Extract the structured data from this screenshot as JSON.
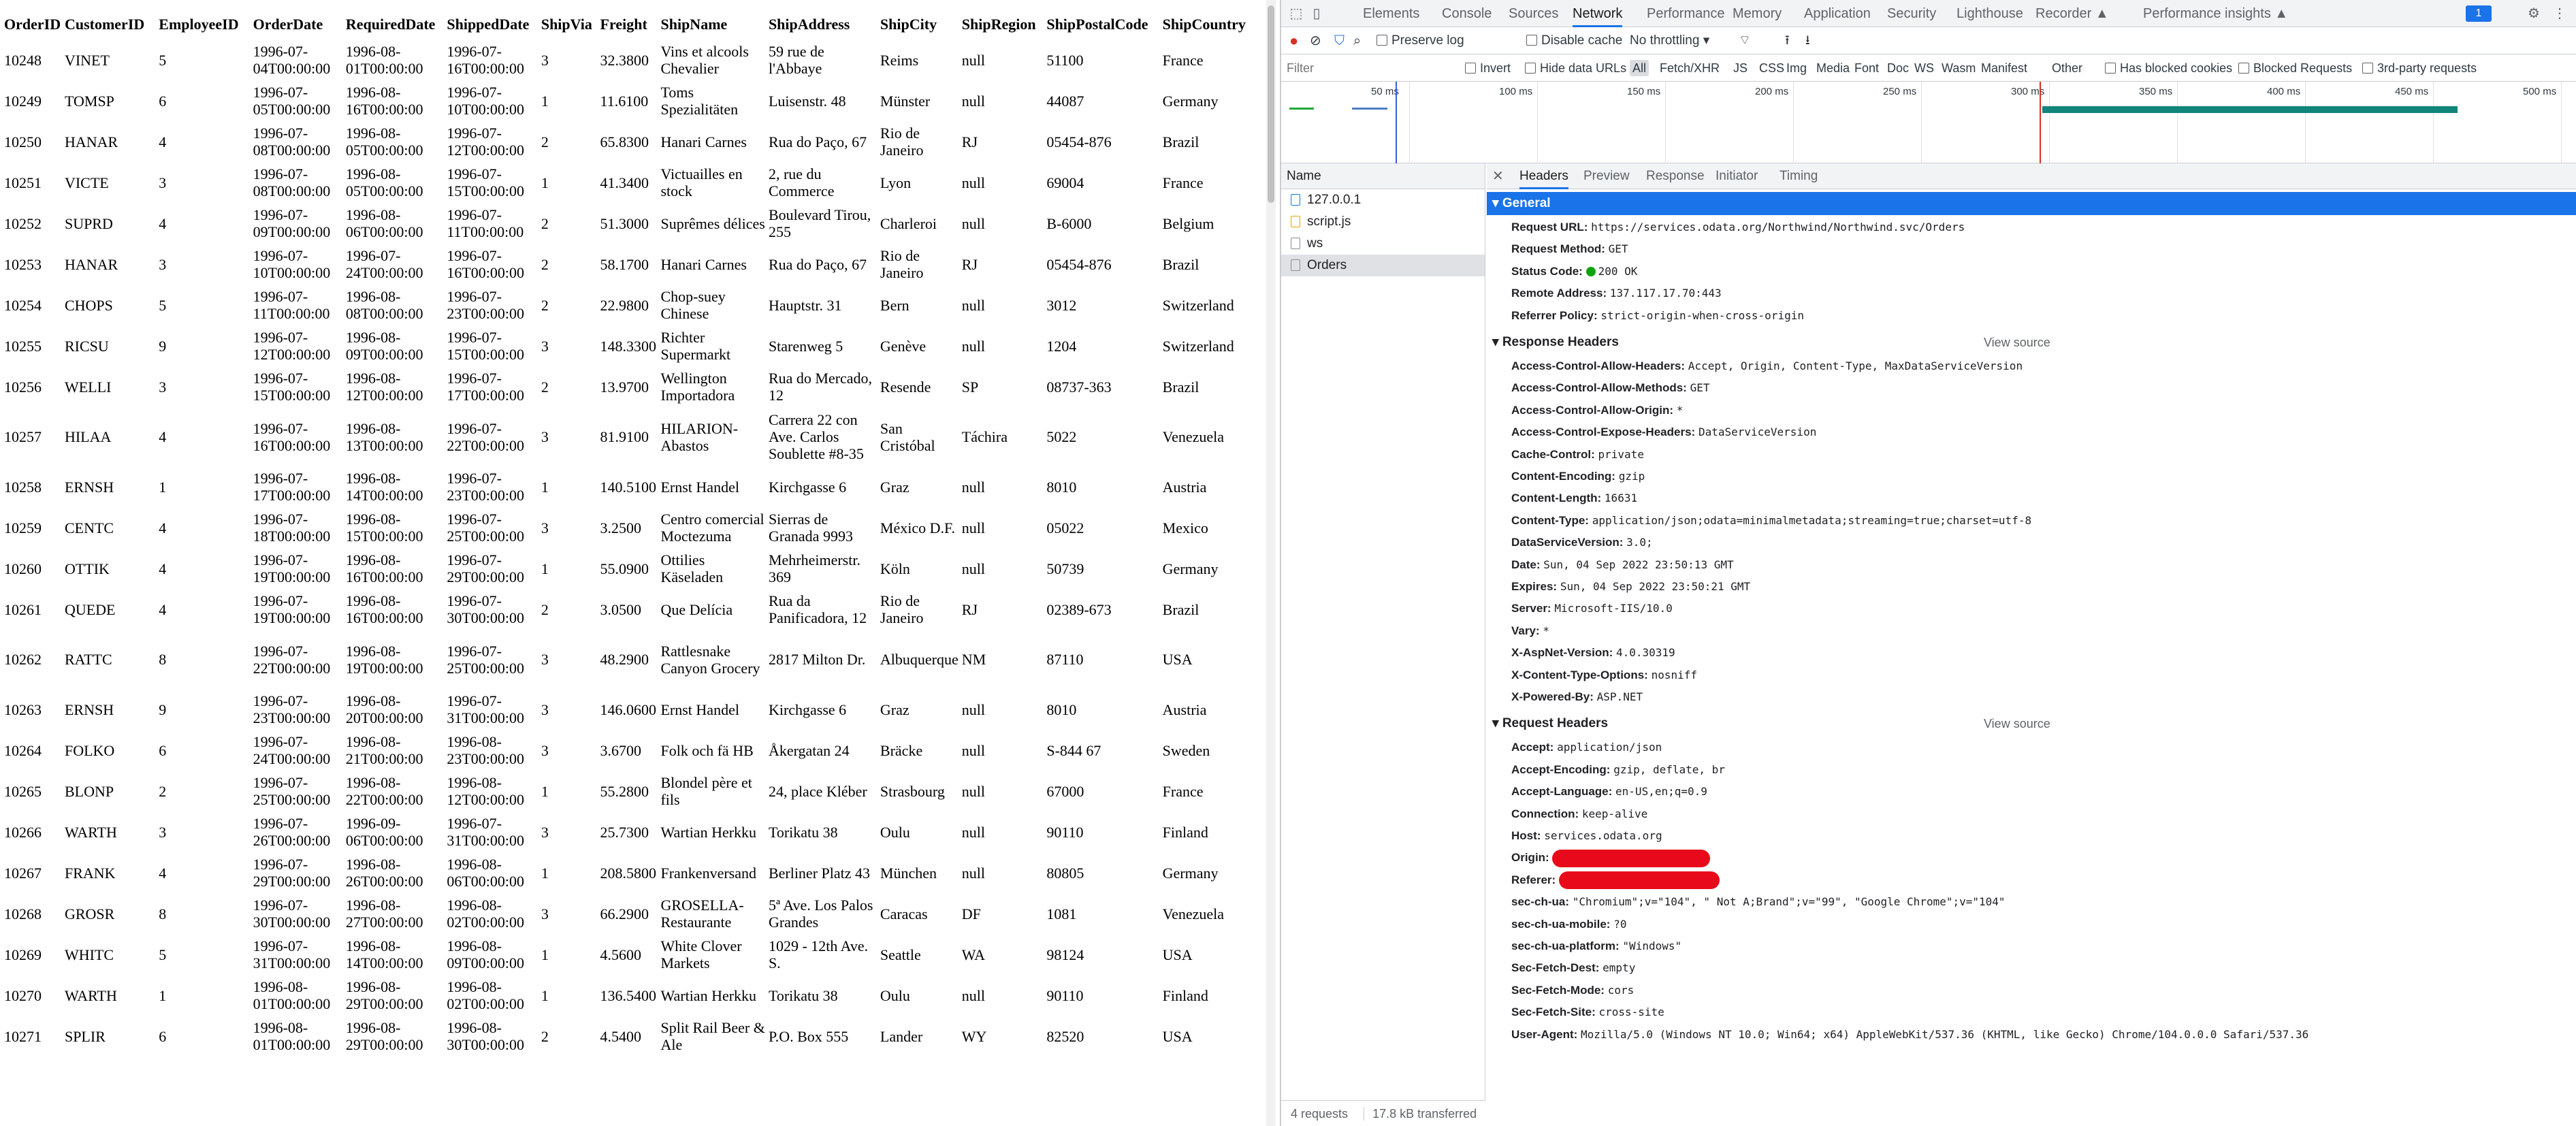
{
  "orders": {
    "headers": [
      "OrderID",
      "CustomerID",
      "EmployeeID",
      "OrderDate",
      "RequiredDate",
      "ShippedDate",
      "ShipVia",
      "Freight",
      "ShipName",
      "ShipAddress",
      "ShipCity",
      "ShipRegion",
      "ShipPostalCode",
      "ShipCountry"
    ],
    "rows": [
      [
        "10248",
        "VINET",
        "5",
        "1996-07-04T00:00:00",
        "1996-08-01T00:00:00",
        "1996-07-16T00:00:00",
        "3",
        "32.3800",
        "Vins et alcools Chevalier",
        "59 rue de l'Abbaye",
        "Reims",
        "null",
        "51100",
        "France"
      ],
      [
        "10249",
        "TOMSP",
        "6",
        "1996-07-05T00:00:00",
        "1996-08-16T00:00:00",
        "1996-07-10T00:00:00",
        "1",
        "11.6100",
        "Toms Spezialitäten",
        "Luisenstr. 48",
        "Münster",
        "null",
        "44087",
        "Germany"
      ],
      [
        "10250",
        "HANAR",
        "4",
        "1996-07-08T00:00:00",
        "1996-08-05T00:00:00",
        "1996-07-12T00:00:00",
        "2",
        "65.8300",
        "Hanari Carnes",
        "Rua do Paço, 67",
        "Rio de Janeiro",
        "RJ",
        "05454-876",
        "Brazil"
      ],
      [
        "10251",
        "VICTE",
        "3",
        "1996-07-08T00:00:00",
        "1996-08-05T00:00:00",
        "1996-07-15T00:00:00",
        "1",
        "41.3400",
        "Victuailles en stock",
        "2, rue du Commerce",
        "Lyon",
        "null",
        "69004",
        "France"
      ],
      [
        "10252",
        "SUPRD",
        "4",
        "1996-07-09T00:00:00",
        "1996-08-06T00:00:00",
        "1996-07-11T00:00:00",
        "2",
        "51.3000",
        "Suprêmes délices",
        "Boulevard Tirou, 255",
        "Charleroi",
        "null",
        "B-6000",
        "Belgium"
      ],
      [
        "10253",
        "HANAR",
        "3",
        "1996-07-10T00:00:00",
        "1996-07-24T00:00:00",
        "1996-07-16T00:00:00",
        "2",
        "58.1700",
        "Hanari Carnes",
        "Rua do Paço, 67",
        "Rio de Janeiro",
        "RJ",
        "05454-876",
        "Brazil"
      ],
      [
        "10254",
        "CHOPS",
        "5",
        "1996-07-11T00:00:00",
        "1996-08-08T00:00:00",
        "1996-07-23T00:00:00",
        "2",
        "22.9800",
        "Chop-suey Chinese",
        "Hauptstr. 31",
        "Bern",
        "null",
        "3012",
        "Switzerland"
      ],
      [
        "10255",
        "RICSU",
        "9",
        "1996-07-12T00:00:00",
        "1996-08-09T00:00:00",
        "1996-07-15T00:00:00",
        "3",
        "148.3300",
        "Richter Supermarkt",
        "Starenweg 5",
        "Genève",
        "null",
        "1204",
        "Switzerland"
      ],
      [
        "10256",
        "WELLI",
        "3",
        "1996-07-15T00:00:00",
        "1996-08-12T00:00:00",
        "1996-07-17T00:00:00",
        "2",
        "13.9700",
        "Wellington Importadora",
        "Rua do Mercado, 12",
        "Resende",
        "SP",
        "08737-363",
        "Brazil"
      ],
      [
        "10257",
        "HILAA",
        "4",
        "1996-07-16T00:00:00",
        "1996-08-13T00:00:00",
        "1996-07-22T00:00:00",
        "3",
        "81.9100",
        "HILARION-Abastos",
        "Carrera 22 con Ave. Carlos Soublette #8-35",
        "San Cristóbal",
        "Táchira",
        "5022",
        "Venezuela"
      ],
      [
        "10258",
        "ERNSH",
        "1",
        "1996-07-17T00:00:00",
        "1996-08-14T00:00:00",
        "1996-07-23T00:00:00",
        "1",
        "140.5100",
        "Ernst Handel",
        "Kirchgasse 6",
        "Graz",
        "null",
        "8010",
        "Austria"
      ],
      [
        "10259",
        "CENTC",
        "4",
        "1996-07-18T00:00:00",
        "1996-08-15T00:00:00",
        "1996-07-25T00:00:00",
        "3",
        "3.2500",
        "Centro comercial Moctezuma",
        "Sierras de Granada 9993",
        "México D.F.",
        "null",
        "05022",
        "Mexico"
      ],
      [
        "10260",
        "OTTIK",
        "4",
        "1996-07-19T00:00:00",
        "1996-08-16T00:00:00",
        "1996-07-29T00:00:00",
        "1",
        "55.0900",
        "Ottilies Käseladen",
        "Mehrheimerstr. 369",
        "Köln",
        "null",
        "50739",
        "Germany"
      ],
      [
        "10261",
        "QUEDE",
        "4",
        "1996-07-19T00:00:00",
        "1996-08-16T00:00:00",
        "1996-07-30T00:00:00",
        "2",
        "3.0500",
        "Que Delícia",
        "Rua da Panificadora, 12",
        "Rio de Janeiro",
        "RJ",
        "02389-673",
        "Brazil"
      ],
      [
        "10262",
        "RATTC",
        "8",
        "1996-07-22T00:00:00",
        "1996-08-19T00:00:00",
        "1996-07-25T00:00:00",
        "3",
        "48.2900",
        "Rattlesnake Canyon Grocery",
        "2817 Milton Dr.",
        "Albuquerque",
        "NM",
        "87110",
        "USA"
      ],
      [
        "10263",
        "ERNSH",
        "9",
        "1996-07-23T00:00:00",
        "1996-08-20T00:00:00",
        "1996-07-31T00:00:00",
        "3",
        "146.0600",
        "Ernst Handel",
        "Kirchgasse 6",
        "Graz",
        "null",
        "8010",
        "Austria"
      ],
      [
        "10264",
        "FOLKO",
        "6",
        "1996-07-24T00:00:00",
        "1996-08-21T00:00:00",
        "1996-08-23T00:00:00",
        "3",
        "3.6700",
        "Folk och fä HB",
        "Åkergatan 24",
        "Bräcke",
        "null",
        "S-844 67",
        "Sweden"
      ],
      [
        "10265",
        "BLONP",
        "2",
        "1996-07-25T00:00:00",
        "1996-08-22T00:00:00",
        "1996-08-12T00:00:00",
        "1",
        "55.2800",
        "Blondel père et fils",
        "24, place Kléber",
        "Strasbourg",
        "null",
        "67000",
        "France"
      ],
      [
        "10266",
        "WARTH",
        "3",
        "1996-07-26T00:00:00",
        "1996-09-06T00:00:00",
        "1996-07-31T00:00:00",
        "3",
        "25.7300",
        "Wartian Herkku",
        "Torikatu 38",
        "Oulu",
        "null",
        "90110",
        "Finland"
      ],
      [
        "10267",
        "FRANK",
        "4",
        "1996-07-29T00:00:00",
        "1996-08-26T00:00:00",
        "1996-08-06T00:00:00",
        "1",
        "208.5800",
        "Frankenversand",
        "Berliner Platz 43",
        "München",
        "null",
        "80805",
        "Germany"
      ],
      [
        "10268",
        "GROSR",
        "8",
        "1996-07-30T00:00:00",
        "1996-08-27T00:00:00",
        "1996-08-02T00:00:00",
        "3",
        "66.2900",
        "GROSELLA-Restaurante",
        "5ª Ave. Los Palos Grandes",
        "Caracas",
        "DF",
        "1081",
        "Venezuela"
      ],
      [
        "10269",
        "WHITC",
        "5",
        "1996-07-31T00:00:00",
        "1996-08-14T00:00:00",
        "1996-08-09T00:00:00",
        "1",
        "4.5600",
        "White Clover Markets",
        "1029 - 12th Ave. S.",
        "Seattle",
        "WA",
        "98124",
        "USA"
      ],
      [
        "10270",
        "WARTH",
        "1",
        "1996-08-01T00:00:00",
        "1996-08-29T00:00:00",
        "1996-08-02T00:00:00",
        "1",
        "136.5400",
        "Wartian Herkku",
        "Torikatu 38",
        "Oulu",
        "null",
        "90110",
        "Finland"
      ],
      [
        "10271",
        "SPLIR",
        "6",
        "1996-08-01T00:00:00",
        "1996-08-29T00:00:00",
        "1996-08-30T00:00:00",
        "2",
        "4.5400",
        "Split Rail Beer & Ale",
        "P.O. Box 555",
        "Lander",
        "WY",
        "82520",
        "USA"
      ]
    ]
  },
  "devtools": {
    "tabs": [
      "Elements",
      "Console",
      "Sources",
      "Network",
      "Performance",
      "Memory",
      "Application",
      "Security",
      "Lighthouse",
      "Recorder ▲",
      "Performance insights ▲"
    ],
    "active_tab": "Network",
    "issues_count": "1",
    "toolbar": {
      "preserve_log": "Preserve log",
      "disable_cache": "Disable cache",
      "throttling": "No throttling"
    },
    "filter": {
      "placeholder": "Filter",
      "invert": "Invert",
      "hide_data_urls": "Hide data URLs",
      "types": [
        "All",
        "Fetch/XHR",
        "JS",
        "CSS",
        "Img",
        "Media",
        "Font",
        "Doc",
        "WS",
        "Wasm",
        "Manifest",
        "Other"
      ],
      "has_blocked_cookies": "Has blocked cookies",
      "blocked_requests": "Blocked Requests",
      "third_party": "3rd-party requests"
    },
    "overview_ticks": [
      "50 ms",
      "100 ms",
      "150 ms",
      "200 ms",
      "250 ms",
      "300 ms",
      "350 ms",
      "400 ms",
      "450 ms",
      "500 ms"
    ],
    "requests": {
      "header": "Name",
      "items": [
        "127.0.0.1",
        "script.js",
        "ws",
        "Orders"
      ],
      "selected": "Orders"
    },
    "status_bar": {
      "requests": "4 requests",
      "transferred": "17.8 kB transferred"
    },
    "detail_tabs": [
      "Headers",
      "Preview",
      "Response",
      "Initiator",
      "Timing"
    ],
    "general": {
      "title": "General",
      "rows": [
        {
          "name": "Request URL:",
          "value": "https://services.odata.org/Northwind/Northwind.svc/Orders"
        },
        {
          "name": "Request Method:",
          "value": "GET"
        },
        {
          "name": "Status Code:",
          "value": "200 OK"
        },
        {
          "name": "Remote Address:",
          "value": "137.117.17.70:443"
        },
        {
          "name": "Referrer Policy:",
          "value": "strict-origin-when-cross-origin"
        }
      ]
    },
    "response_headers": {
      "title": "Response Headers",
      "view_source": "View source",
      "rows": [
        {
          "name": "Access-Control-Allow-Headers:",
          "value": "Accept, Origin, Content-Type, MaxDataServiceVersion"
        },
        {
          "name": "Access-Control-Allow-Methods:",
          "value": "GET"
        },
        {
          "name": "Access-Control-Allow-Origin:",
          "value": "*"
        },
        {
          "name": "Access-Control-Expose-Headers:",
          "value": "DataServiceVersion"
        },
        {
          "name": "Cache-Control:",
          "value": "private"
        },
        {
          "name": "Content-Encoding:",
          "value": "gzip"
        },
        {
          "name": "Content-Length:",
          "value": "16631"
        },
        {
          "name": "Content-Type:",
          "value": "application/json;odata=minimalmetadata;streaming=true;charset=utf-8"
        },
        {
          "name": "DataServiceVersion:",
          "value": "3.0;"
        },
        {
          "name": "Date:",
          "value": "Sun, 04 Sep 2022 23:50:13 GMT"
        },
        {
          "name": "Expires:",
          "value": "Sun, 04 Sep 2022 23:50:21 GMT"
        },
        {
          "name": "Server:",
          "value": "Microsoft-IIS/10.0"
        },
        {
          "name": "Vary:",
          "value": "*"
        },
        {
          "name": "X-AspNet-Version:",
          "value": "4.0.30319"
        },
        {
          "name": "X-Content-Type-Options:",
          "value": "nosniff"
        },
        {
          "name": "X-Powered-By:",
          "value": "ASP.NET"
        }
      ]
    },
    "request_headers": {
      "title": "Request Headers",
      "view_source": "View source",
      "rows": [
        {
          "name": "Accept:",
          "value": "application/json"
        },
        {
          "name": "Accept-Encoding:",
          "value": "gzip, deflate, br"
        },
        {
          "name": "Accept-Language:",
          "value": "en-US,en;q=0.9"
        },
        {
          "name": "Connection:",
          "value": "keep-alive"
        },
        {
          "name": "Host:",
          "value": "services.odata.org"
        },
        {
          "name": "Origin:",
          "value": ""
        },
        {
          "name": "Referer:",
          "value": ""
        },
        {
          "name": "sec-ch-ua:",
          "value": "\"Chromium\";v=\"104\", \" Not A;Brand\";v=\"99\", \"Google Chrome\";v=\"104\""
        },
        {
          "name": "sec-ch-ua-mobile:",
          "value": "?0"
        },
        {
          "name": "sec-ch-ua-platform:",
          "value": "\"Windows\""
        },
        {
          "name": "Sec-Fetch-Dest:",
          "value": "empty"
        },
        {
          "name": "Sec-Fetch-Mode:",
          "value": "cors"
        },
        {
          "name": "Sec-Fetch-Site:",
          "value": "cross-site"
        },
        {
          "name": "User-Agent:",
          "value": "Mozilla/5.0 (Windows NT 10.0; Win64; x64) AppleWebKit/537.36 (KHTML, like Gecko) Chrome/104.0.0.0 Safari/537.36"
        }
      ]
    },
    "colors": {
      "accent": "#1a73e8",
      "status_ok": "#0ca30c",
      "redaction": "#e8091a",
      "timeline_bar": "#12857a"
    }
  }
}
